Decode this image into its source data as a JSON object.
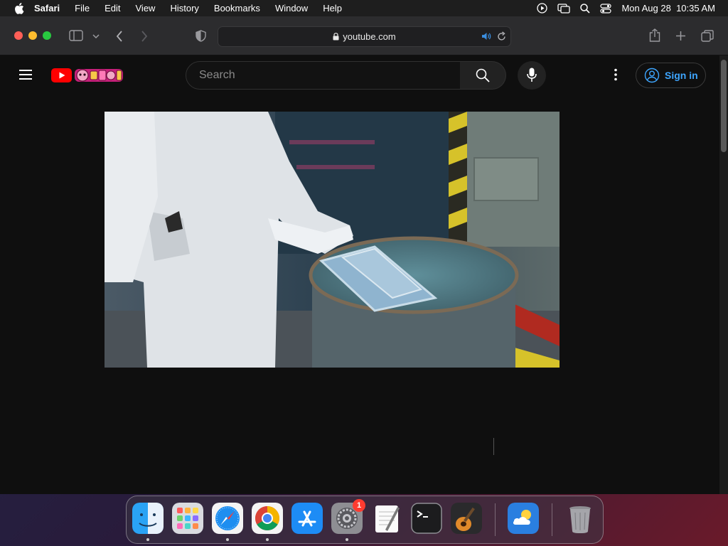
{
  "menubar": {
    "app_name": "Safari",
    "items": [
      "File",
      "Edit",
      "View",
      "History",
      "Bookmarks",
      "Window",
      "Help"
    ],
    "clock": "Mon Aug 28  10:35 AM"
  },
  "browser": {
    "url": "youtube.com"
  },
  "youtube": {
    "search_placeholder": "Search",
    "sign_in_label": "Sign in",
    "colors": {
      "brand_red": "#ff0000",
      "link_blue": "#3ea6ff"
    }
  },
  "dock": {
    "apps": [
      "Finder",
      "Launchpad",
      "Safari",
      "Google Chrome",
      "App Store",
      "System Settings",
      "TextEdit",
      "Terminal",
      "GarageBand",
      "Weather",
      "Trash"
    ],
    "system_settings_badge": "1"
  }
}
